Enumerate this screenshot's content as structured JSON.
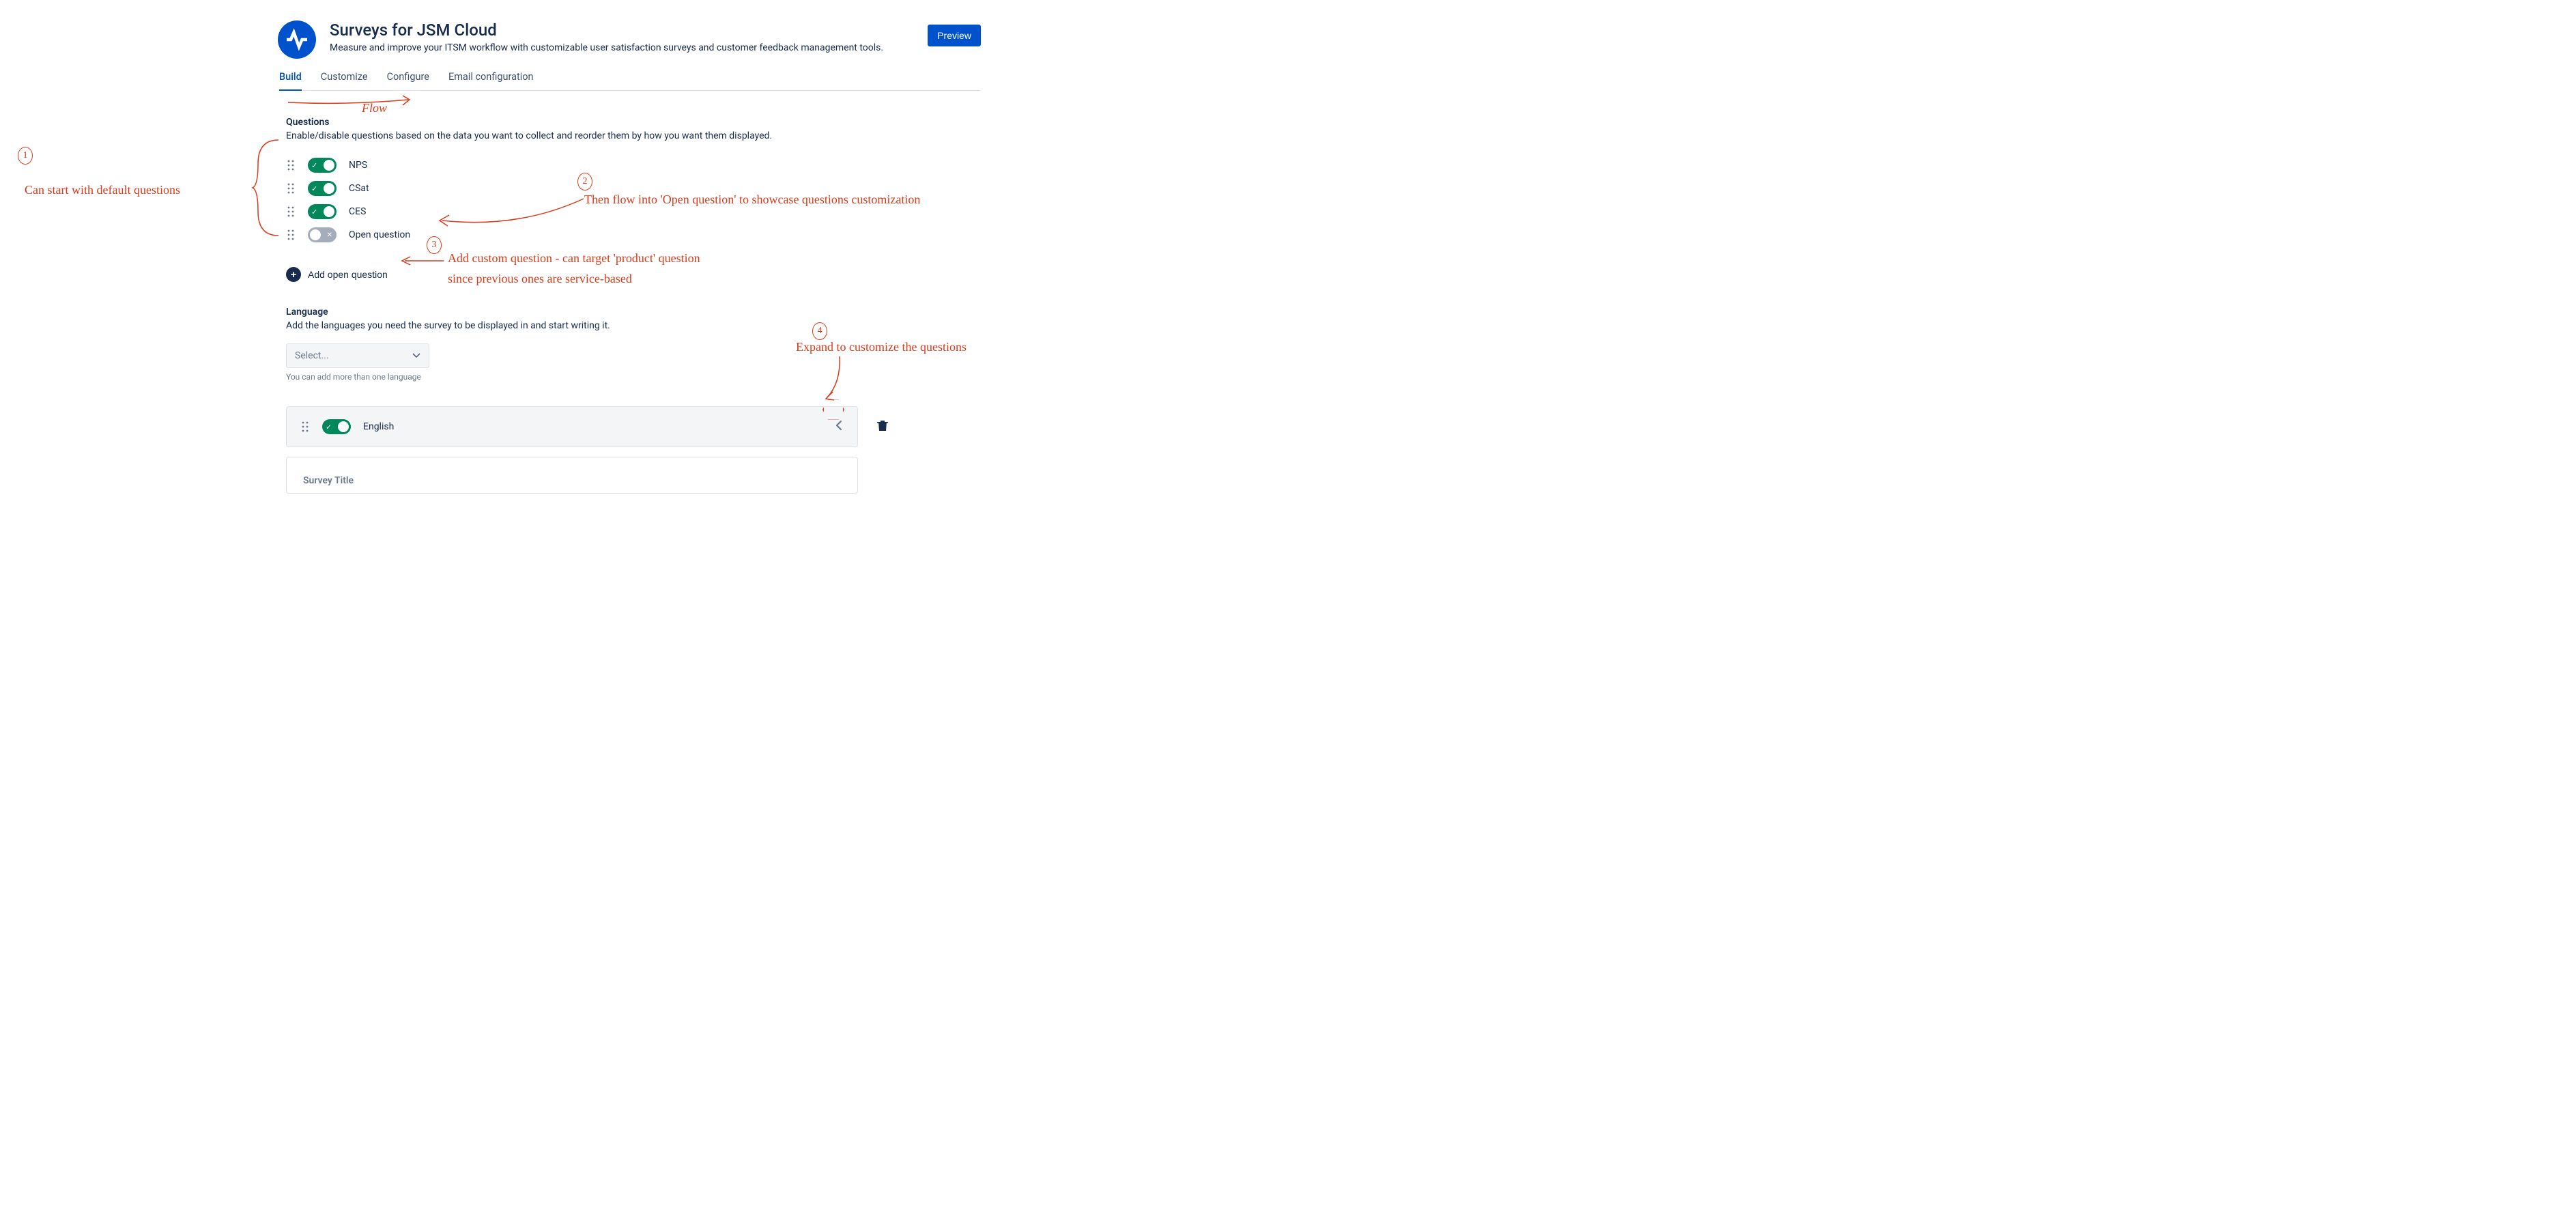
{
  "header": {
    "title": "Surveys for JSM Cloud",
    "subtitle": "Measure and improve your ITSM workflow with customizable user satisfaction surveys and customer feedback management tools.",
    "preview_button": "Preview"
  },
  "tabs": [
    {
      "label": "Build",
      "active": true
    },
    {
      "label": "Customize",
      "active": false
    },
    {
      "label": "Configure",
      "active": false
    },
    {
      "label": "Email configuration",
      "active": false
    }
  ],
  "questions_section": {
    "heading": "Questions",
    "description": "Enable/disable questions based on the data you want to collect and reorder them by how you want them displayed.",
    "items": [
      {
        "label": "NPS",
        "enabled": true
      },
      {
        "label": "CSat",
        "enabled": true
      },
      {
        "label": "CES",
        "enabled": true
      },
      {
        "label": "Open question",
        "enabled": false
      }
    ],
    "add_button": "Add open question"
  },
  "language_section": {
    "heading": "Language",
    "description": "Add the languages you need the survey to be displayed in and start writing it.",
    "select_placeholder": "Select...",
    "select_helper": "You can add more than one language",
    "language_item": {
      "label": "English",
      "enabled": true
    },
    "survey_title_label": "Survey Title"
  },
  "annotations": {
    "num1": "1",
    "num2": "2",
    "num3": "3",
    "num4": "4",
    "flow": "Flow",
    "text1": "Can start with default questions",
    "text2": "Then flow into 'Open question' to showcase questions customization",
    "text3a": "Add custom question - can target 'product' question",
    "text3b": "since previous ones are service-based",
    "text4": "Expand to customize the questions"
  }
}
